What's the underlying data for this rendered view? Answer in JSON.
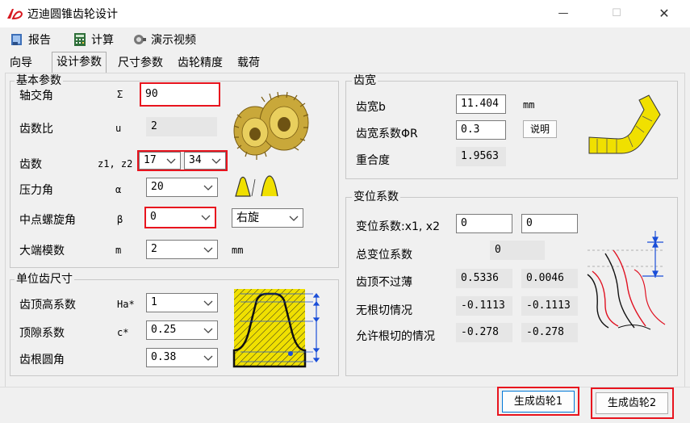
{
  "window": {
    "title": "迈迪圆锥齿轮设计",
    "min_glyph": "—",
    "max_glyph": "☐",
    "close_glyph": "✕"
  },
  "toolbar": {
    "report_label": "报告",
    "calc_label": "计算",
    "video_label": "演示视频"
  },
  "tabs": [
    "向导",
    "设计参数",
    "尺寸参数",
    "齿轮精度",
    "载荷"
  ],
  "active_tab": "设计参数",
  "basic": {
    "title": "基本参数",
    "shaft_angle": {
      "label": "轴交角",
      "symbol": "Σ",
      "value": "90"
    },
    "ratio": {
      "label": "齿数比",
      "symbol": "u",
      "value": "2"
    },
    "teeth": {
      "label": "齿数",
      "symbol": "z1, z2",
      "z1": "17",
      "z2": "34"
    },
    "pressure": {
      "label": "压力角",
      "symbol": "α",
      "value": "20"
    },
    "spiral": {
      "label": "中点螺旋角",
      "symbol": "β",
      "value": "0",
      "hand": "右旋"
    },
    "module": {
      "label": "大端模数",
      "symbol": "m",
      "value": "2",
      "unit": "mm"
    }
  },
  "unit": {
    "title": "单位齿尺寸",
    "addendum": {
      "label": "齿顶高系数",
      "symbol": "Ha*",
      "value": "1"
    },
    "clearance": {
      "label": "顶隙系数",
      "symbol": "c*",
      "value": "0.25"
    },
    "root": {
      "label": "齿根圆角",
      "value": "0.38"
    }
  },
  "width": {
    "title": "齿宽",
    "b": {
      "label": "齿宽b",
      "value": "11.404",
      "unit": "mm"
    },
    "phi": {
      "label": "齿宽系数ΦR",
      "value": "0.3",
      "btn": "说明"
    },
    "overlap": {
      "label": "重合度",
      "value": "1.9563"
    }
  },
  "shift": {
    "title": "变位系数",
    "x": {
      "label": "变位系数:x1, x2",
      "x1": "0",
      "x2": "0"
    },
    "total": {
      "label": "总变位系数",
      "value": "0"
    },
    "tip": {
      "label": "齿顶不过薄",
      "v1": "0.5336",
      "v2": "0.0046"
    },
    "undercut": {
      "label": "无根切情况",
      "v1": "-0.1113",
      "v2": "-0.1113"
    },
    "allowed": {
      "label": "允许根切的情况",
      "v1": "-0.278",
      "v2": "-0.278"
    }
  },
  "buttons": {
    "gen1": "生成齿轮1",
    "gen2": "生成齿轮2"
  },
  "colors": {
    "highlight": "#e8141e",
    "gear_yellow": "#f0e000",
    "accent_blue": "#1a4ed8"
  }
}
